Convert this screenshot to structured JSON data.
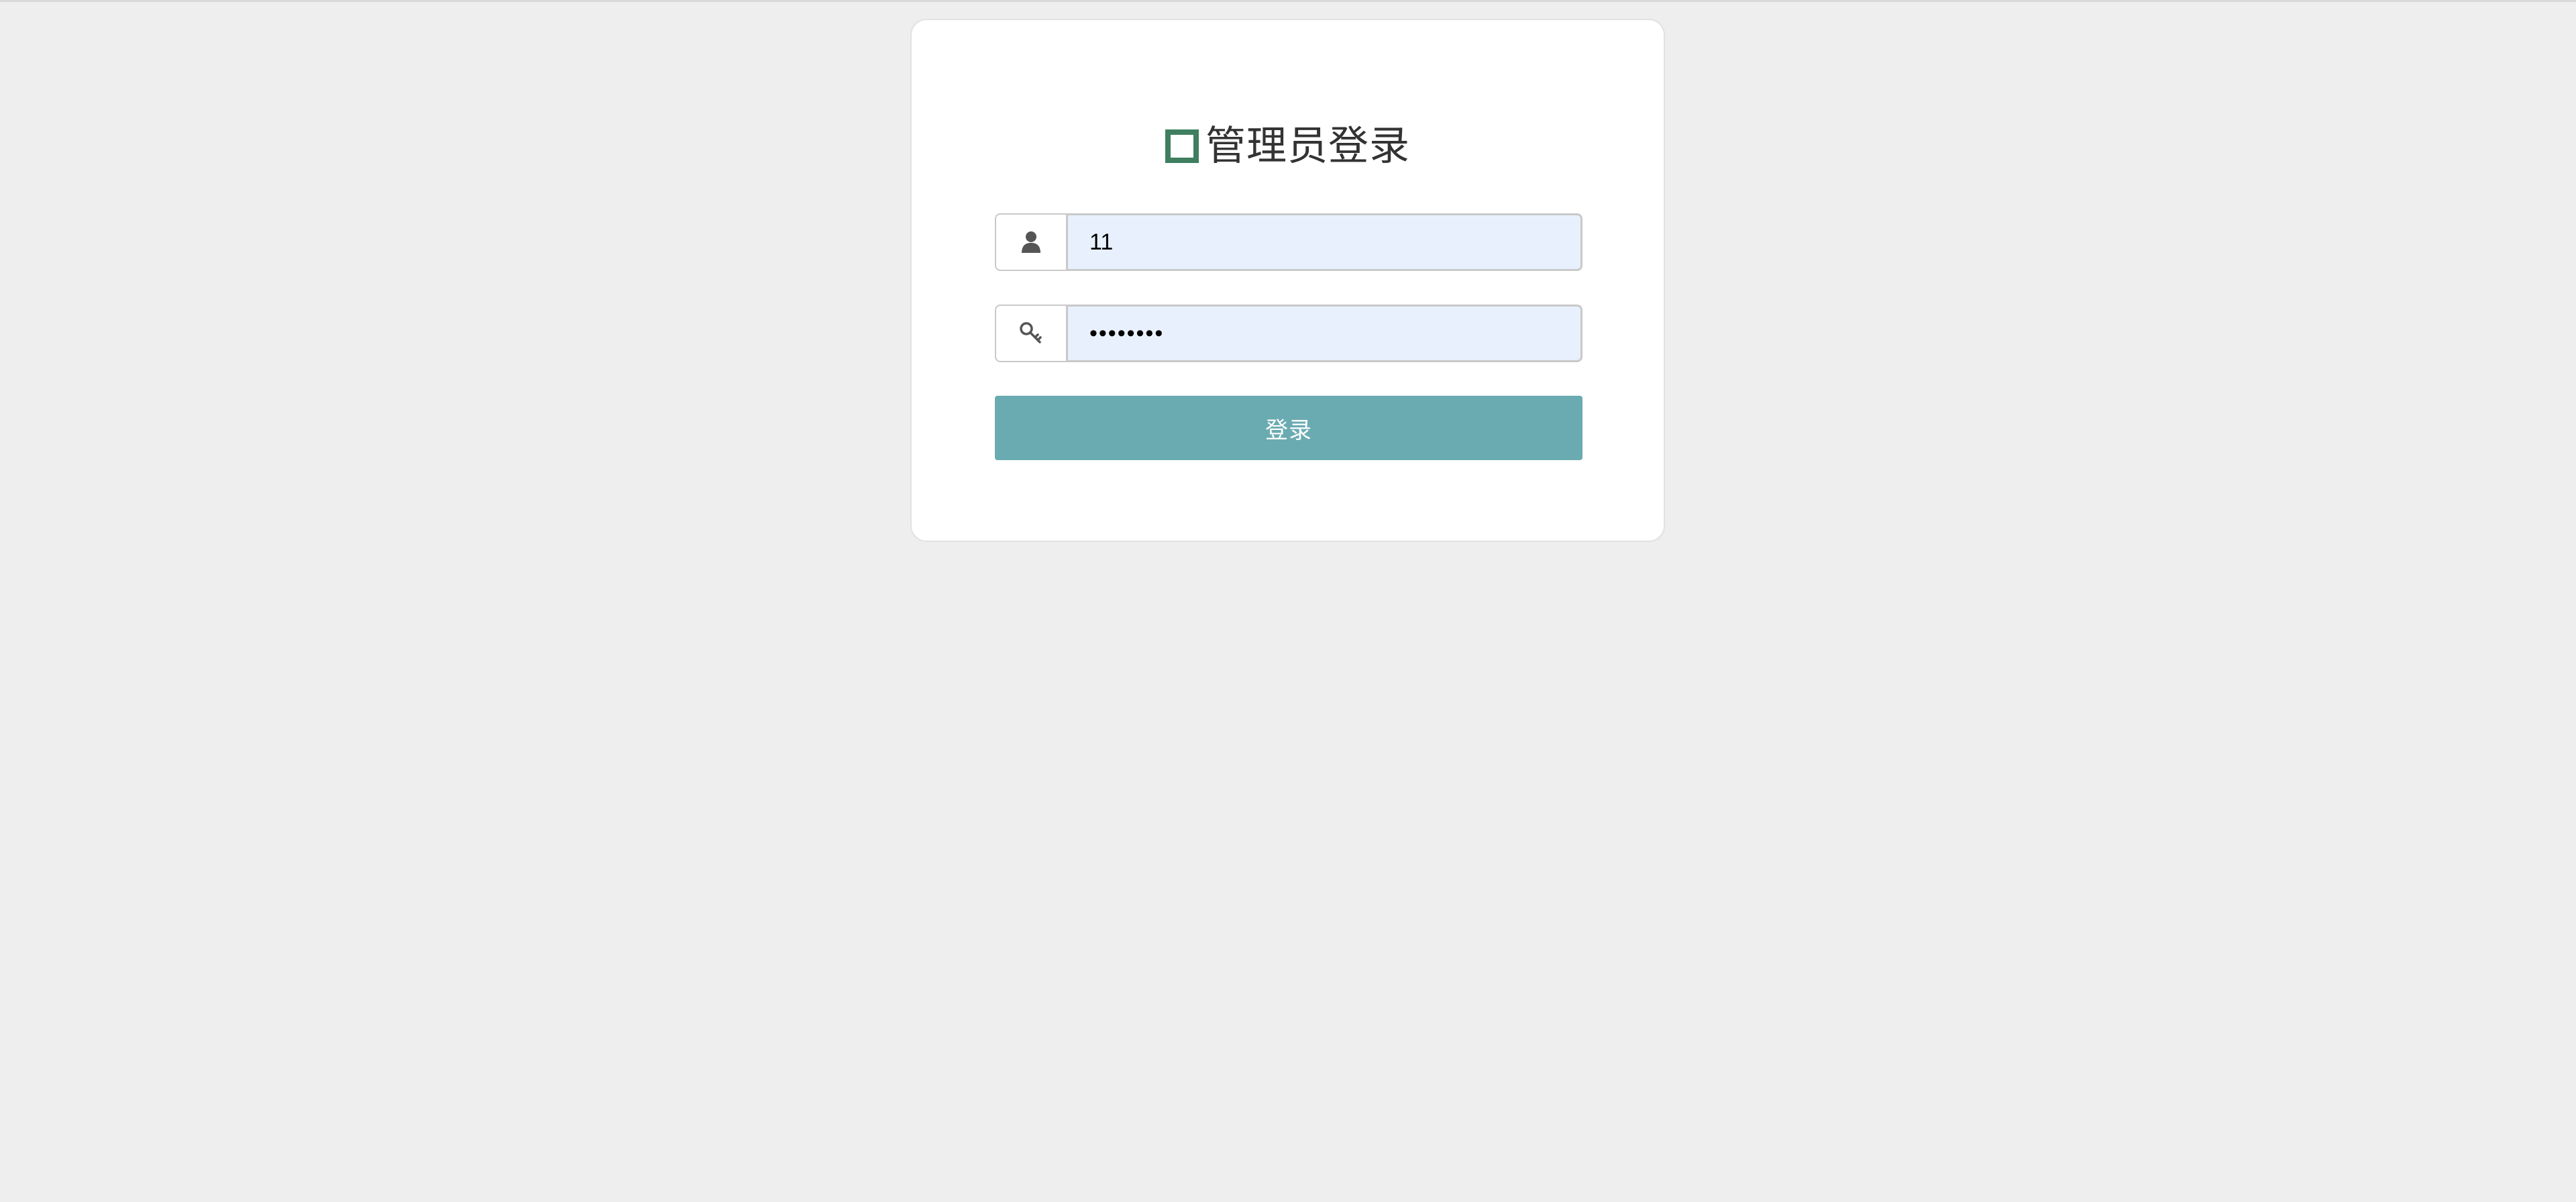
{
  "page": {
    "title": "管理员登录",
    "title_icon": "square-outline-icon",
    "accent_color": "#3f7f5f"
  },
  "form": {
    "username": {
      "icon": "user-icon",
      "value": "11"
    },
    "password": {
      "icon": "key-icon",
      "value": "••••••••"
    },
    "submit_label": "登录",
    "submit_color": "#6aabb1"
  }
}
